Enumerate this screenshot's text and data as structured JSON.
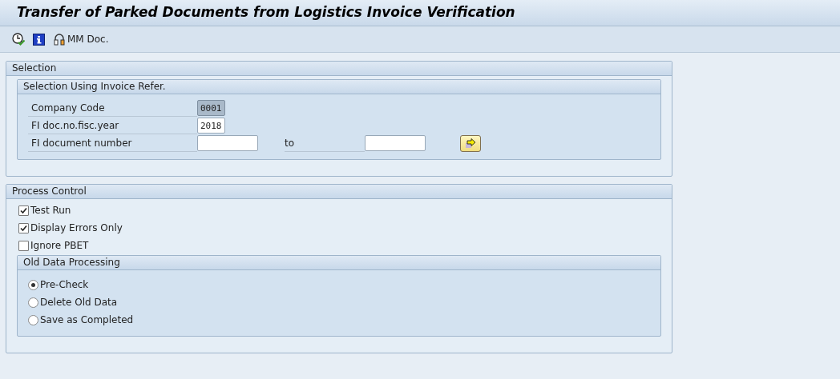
{
  "window": {
    "title": "Transfer of Parked Documents from Logistics Invoice Verification"
  },
  "toolbar": [
    {
      "kind": "clock"
    },
    {
      "kind": "info"
    },
    {
      "kind": "headset",
      "label": "MM Doc."
    }
  ],
  "selection": {
    "title": "Selection",
    "subgroup": {
      "title": "Selection Using Invoice Refer.",
      "fields": [
        {
          "label": "Company Code",
          "value": "0001",
          "readonly": true,
          "range": false
        },
        {
          "label": "FI doc.no.fisc.year",
          "value": "2018",
          "readonly": false,
          "range": false
        },
        {
          "label": "FI document number",
          "readonly": false,
          "to_label": "to",
          "range": true
        }
      ]
    }
  },
  "process_control": {
    "title": "Process Control",
    "checkboxes": [
      {
        "label": "Test Run",
        "checked": true
      },
      {
        "label": "Display Errors Only",
        "checked": true
      },
      {
        "label": "Ignore PBET",
        "checked": false
      }
    ],
    "subgroup": {
      "title": "Old Data Processing",
      "radios": [
        {
          "label": "Pre-Check",
          "selected": true
        },
        {
          "label": "Delete Old Data",
          "selected": false
        },
        {
          "label": "Save as Completed",
          "selected": false
        }
      ]
    }
  }
}
